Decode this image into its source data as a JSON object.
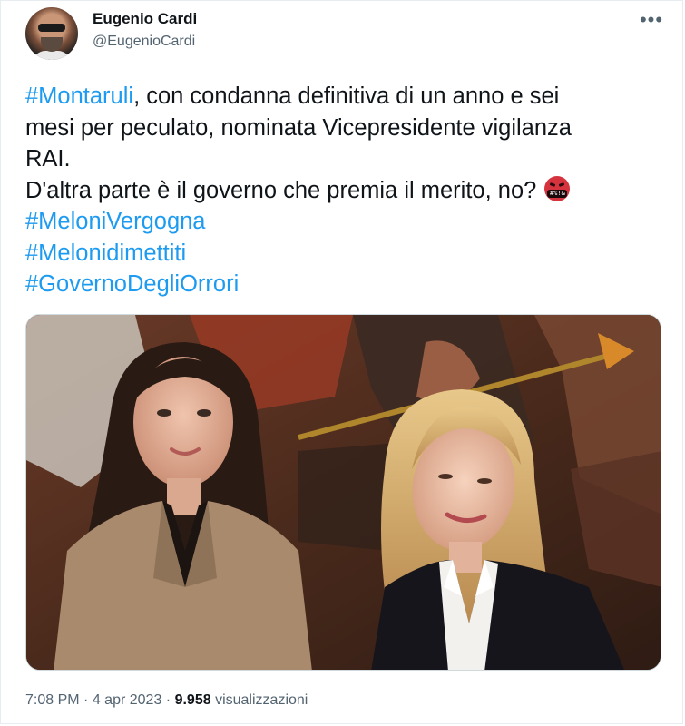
{
  "author": {
    "name": "Eugenio Cardi",
    "handle": "@EugenioCardi"
  },
  "tweet": {
    "hashtag_1": "#Montaruli",
    "line_1_rest": ", con condanna definitiva di un anno e sei",
    "line_2": "mesi per peculato, nominata Vicepresidente vigilanza",
    "line_3": "RAI.",
    "line_4": "D'altra parte è il governo che premia il merito, no?",
    "emoji_text": "#%!&",
    "hashtags": [
      "#MeloniVergogna",
      "#Melonidimettiti",
      "#GovernoDegliOrrori"
    ]
  },
  "meta": {
    "time": "7:08 PM",
    "separator": "·",
    "date": "4 apr 2023",
    "views_count": "9.958",
    "views_label": "visualizzazioni"
  },
  "icons": {
    "more": "more-horizontal-icon",
    "emoji": "face-with-symbols-on-mouth"
  },
  "colors": {
    "hashtag": "#1d9bf0",
    "text": "#0f1419",
    "secondary": "#536471"
  }
}
